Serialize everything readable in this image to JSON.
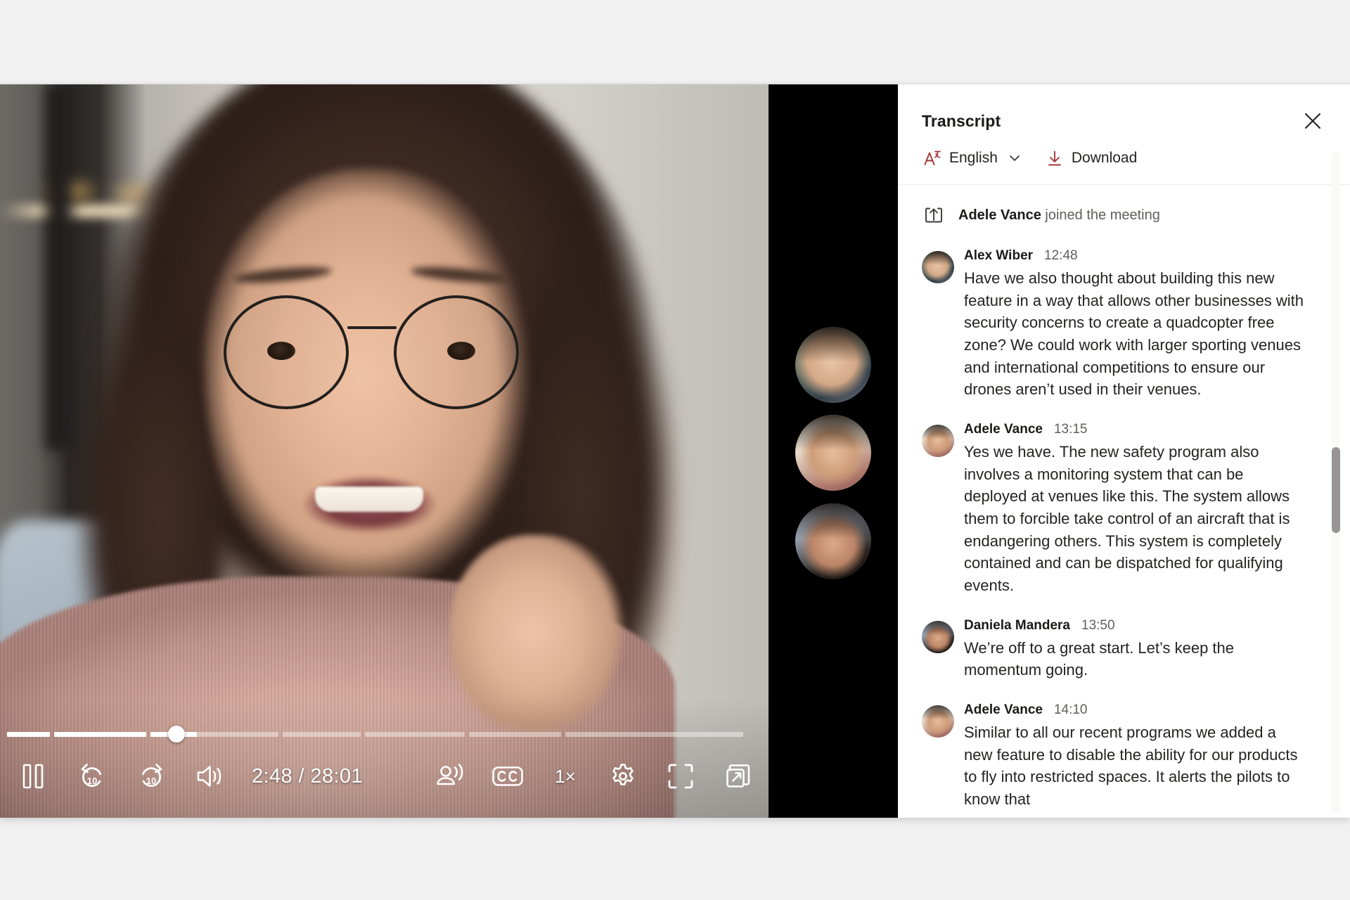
{
  "player": {
    "current_time": "2:48",
    "total_time": "28:01",
    "time_display": "2:48 / 28:01",
    "playback_speed": "1×",
    "progress_percent": 23,
    "state": "playing",
    "controls": {
      "pause_label": "Pause",
      "rewind_label": "Rewind 10 seconds",
      "rewind_seconds": "10",
      "forward_label": "Forward 10 seconds",
      "forward_seconds": "10",
      "volume_label": "Volume",
      "speaker_coach_label": "Speaker view",
      "captions_label": "CC",
      "settings_label": "Settings",
      "fullscreen_label": "Full screen",
      "popout_label": "Pop out"
    },
    "chapters": [
      {
        "percent_width": 6,
        "filled": 100
      },
      {
        "percent_width": 13,
        "filled": 100
      },
      {
        "percent_width": 18,
        "filled": 36
      },
      {
        "percent_width": 11,
        "filled": 0
      },
      {
        "percent_width": 14,
        "filled": 0
      },
      {
        "percent_width": 13,
        "filled": 0
      },
      {
        "percent_width": 25,
        "filled": 0
      }
    ]
  },
  "gallery": {
    "participants": [
      {
        "name": "Alex Wiber",
        "tone": "t1"
      },
      {
        "name": "Adele Vance",
        "tone": "t2"
      },
      {
        "name": "Daniela Mandera",
        "tone": "t3"
      }
    ]
  },
  "transcript": {
    "title": "Transcript",
    "close_label": "Close",
    "language": "English",
    "download_label": "Download",
    "scroll_position_percent": 62,
    "entries": [
      {
        "type": "system",
        "speaker": "Adele Vance",
        "system_text": "joined the meeting"
      },
      {
        "type": "message",
        "speaker": "Alex Wiber",
        "time": "12:48",
        "avatar": "alex",
        "text": "Have we also thought about building this new feature in a way that allows other businesses with security concerns to create a quadcopter free zone? We could work with larger sporting venues and international competitions to ensure our drones aren’t used in their venues."
      },
      {
        "type": "message",
        "speaker": "Adele Vance",
        "time": "13:15",
        "avatar": "adele",
        "text": "Yes we have. The new safety program also involves a monitoring system that can be deployed at venues like this. The system allows them to forcible take control of an aircraft that is endangering others. This system is completely contained and can be dispatched for qualifying events."
      },
      {
        "type": "message",
        "speaker": "Daniela Mandera",
        "time": "13:50",
        "avatar": "daniela",
        "text": "We’re off to a great start. Let’s keep the momentum going."
      },
      {
        "type": "message",
        "speaker": "Adele Vance",
        "time": "14:10",
        "avatar": "adele",
        "text": "Similar to all our recent programs we added a new feature to disable the ability for our products to fly into restricted spaces. It alerts the pilots to know that"
      }
    ]
  },
  "colors": {
    "accent": "#a4373a",
    "panel_background": "#ffffff",
    "page_background": "#f1f1f1",
    "gallery_background": "#000000",
    "text_primary": "#242322",
    "text_secondary": "#605e5c",
    "scrollbar_thumb": "#979593"
  }
}
